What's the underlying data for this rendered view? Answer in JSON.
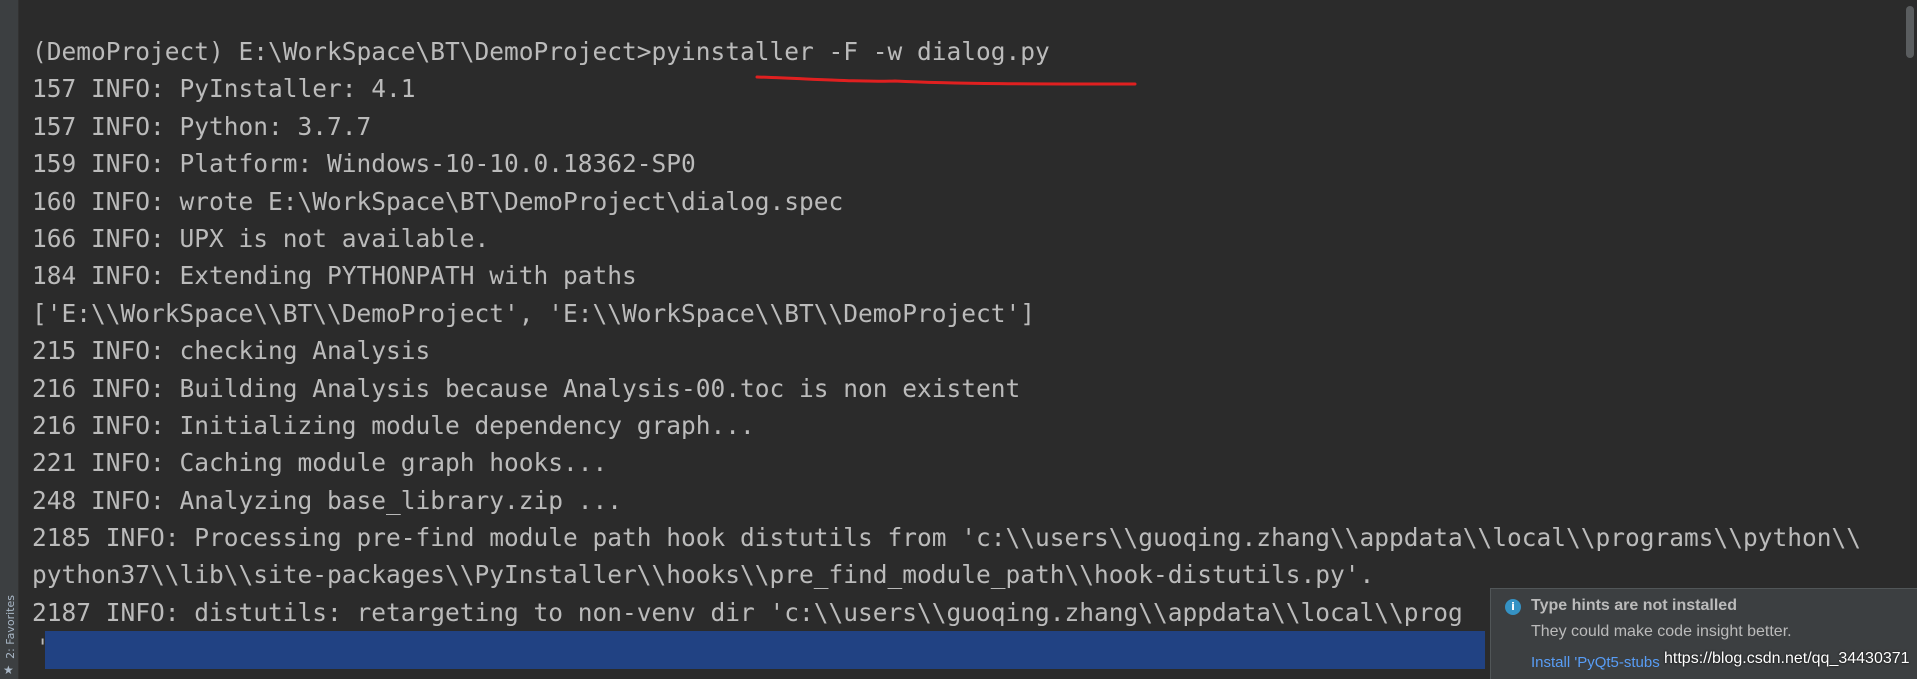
{
  "terminal": {
    "lines": [
      "(DemoProject) E:\\WorkSpace\\BT\\DemoProject>pyinstaller -F -w dialog.py",
      "157 INFO: PyInstaller: 4.1",
      "157 INFO: Python: 3.7.7",
      "159 INFO: Platform: Windows-10-10.0.18362-SP0",
      "160 INFO: wrote E:\\WorkSpace\\BT\\DemoProject\\dialog.spec",
      "166 INFO: UPX is not available.",
      "184 INFO: Extending PYTHONPATH with paths",
      "['E:\\\\WorkSpace\\\\BT\\\\DemoProject', 'E:\\\\WorkSpace\\\\BT\\\\DemoProject']",
      "215 INFO: checking Analysis",
      "216 INFO: Building Analysis because Analysis-00.toc is non existent",
      "216 INFO: Initializing module dependency graph...",
      "221 INFO: Caching module graph hooks...",
      "248 INFO: Analyzing base_library.zip ...",
      "2185 INFO: Processing pre-find module path hook distutils from 'c:\\\\users\\\\guoqing.zhang\\\\appdata\\\\local\\\\programs\\\\python\\\\",
      "python37\\\\lib\\\\site-packages\\\\PyInstaller\\\\hooks\\\\pre_find_module_path\\\\hook-distutils.py'.",
      "2187 INFO: distutils: retargeting to non-venv dir 'c:\\\\users\\\\guoqing.zhang\\\\appdata\\\\local\\\\prog"
    ],
    "cursor_char": "'"
  },
  "sidebar": {
    "favorites_label": "2: Favorites",
    "favorites_icon": "star-icon"
  },
  "notification": {
    "icon": "info-icon",
    "icon_glyph": "i",
    "title": "Type hints are not installed",
    "body": "They could make code insight better.",
    "link": "Install 'PyQt5-stubs"
  },
  "watermark": "https://blog.csdn.net/qq_34430371",
  "colors": {
    "background": "#2b2b2b",
    "text": "#bbbbbb",
    "selection": "#214283",
    "annotation": "#e02020",
    "link": "#589df6",
    "info": "#3592c4"
  }
}
